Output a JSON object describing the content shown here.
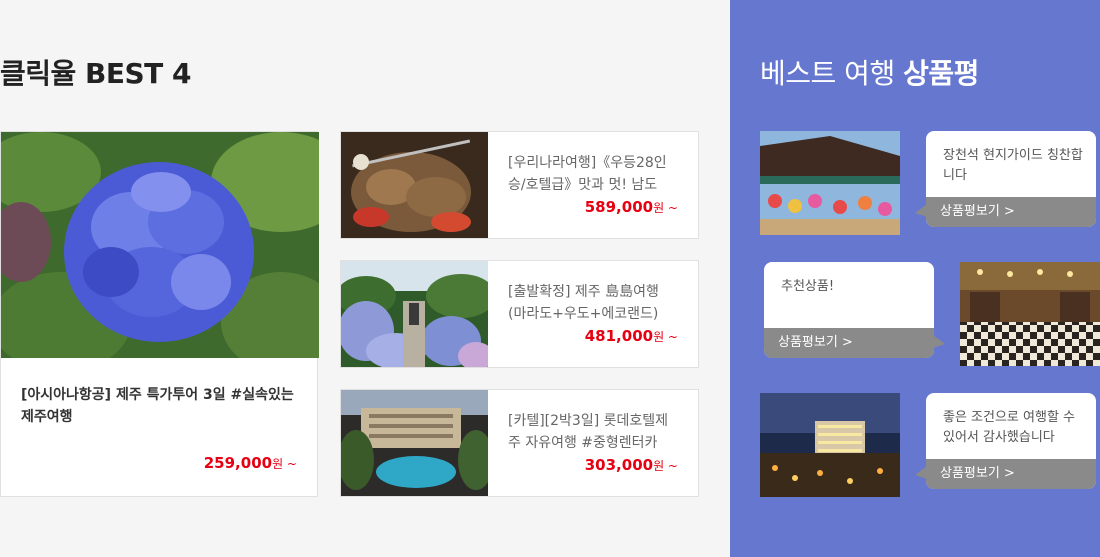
{
  "left_section": {
    "title": "클릭율 BEST 4",
    "featured": {
      "title": "[아시아나항공] 제주 특가투어 3일 #실속있는 제주여행",
      "price": "259,000",
      "price_suffix": "원 ~",
      "image": "blue-hydrangea-photo"
    },
    "items": [
      {
        "title": "[우리나라여행]《우등28인승/호텔급》맛과 멋! 남도",
        "price": "589,000",
        "price_suffix": "원 ~",
        "image": "korean-food-photo"
      },
      {
        "title": "[출발확정] 제주 島島여행 (마라도+우도+에코랜드)",
        "price": "481,000",
        "price_suffix": "원 ~",
        "image": "hydrangea-garden-photo"
      },
      {
        "title": "[카텔][2박3일] 롯데호텔제주 자유여행 #중형렌터카",
        "price": "303,000",
        "price_suffix": "원 ~",
        "image": "resort-pool-photo"
      }
    ]
  },
  "review_section": {
    "title_normal": "베스트 여행",
    "title_bold": "상품평",
    "reviews": [
      {
        "text": "장천석 현지가이드 칭찬합니다",
        "button": "상품평보기 >",
        "image": "temple-lanterns-photo"
      },
      {
        "text": "추천상품!",
        "button": "상품평보기 >",
        "image": "checkered-hall-photo"
      },
      {
        "text": "좋은 조건으로 여행할 수 있어서 감사했습니다",
        "button": "상품평보기 >",
        "image": "night-city-photo"
      }
    ]
  },
  "colors": {
    "price": "#e60012",
    "review_bg": "#6677cf",
    "bubble_button": "#8a8a8a"
  }
}
